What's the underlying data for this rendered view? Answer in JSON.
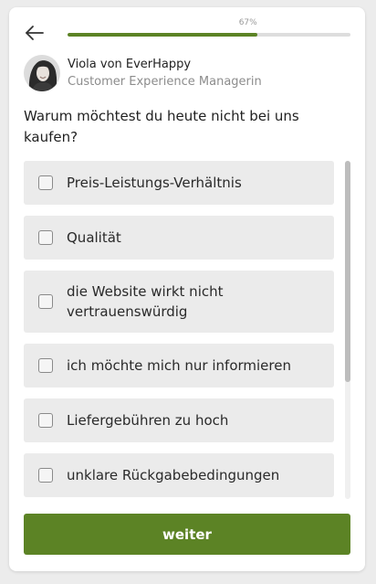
{
  "colors": {
    "accent": "#5c8325",
    "progress_track": "#dddddd",
    "option_background": "#ebebeb"
  },
  "header": {
    "back_icon": "arrow-left-icon",
    "progress": {
      "label": "67%",
      "value": 0.67
    }
  },
  "agent": {
    "name": "Viola von EverHappy",
    "role": "Customer Experience Managerin"
  },
  "question": {
    "text": "Warum möchtest du heute nicht bei uns kaufen?"
  },
  "options": [
    {
      "label": "Preis-Leistungs-Verhältnis",
      "checked": false
    },
    {
      "label": "Qualität",
      "checked": false
    },
    {
      "label": "die Website wirkt nicht vertrauenswürdig",
      "checked": false
    },
    {
      "label": "ich möchte mich nur informieren",
      "checked": false
    },
    {
      "label": "Liefergebühren zu hoch",
      "checked": false
    },
    {
      "label": "unklare Rückgabebedingungen",
      "checked": false
    }
  ],
  "submit": {
    "label": "weiter"
  }
}
